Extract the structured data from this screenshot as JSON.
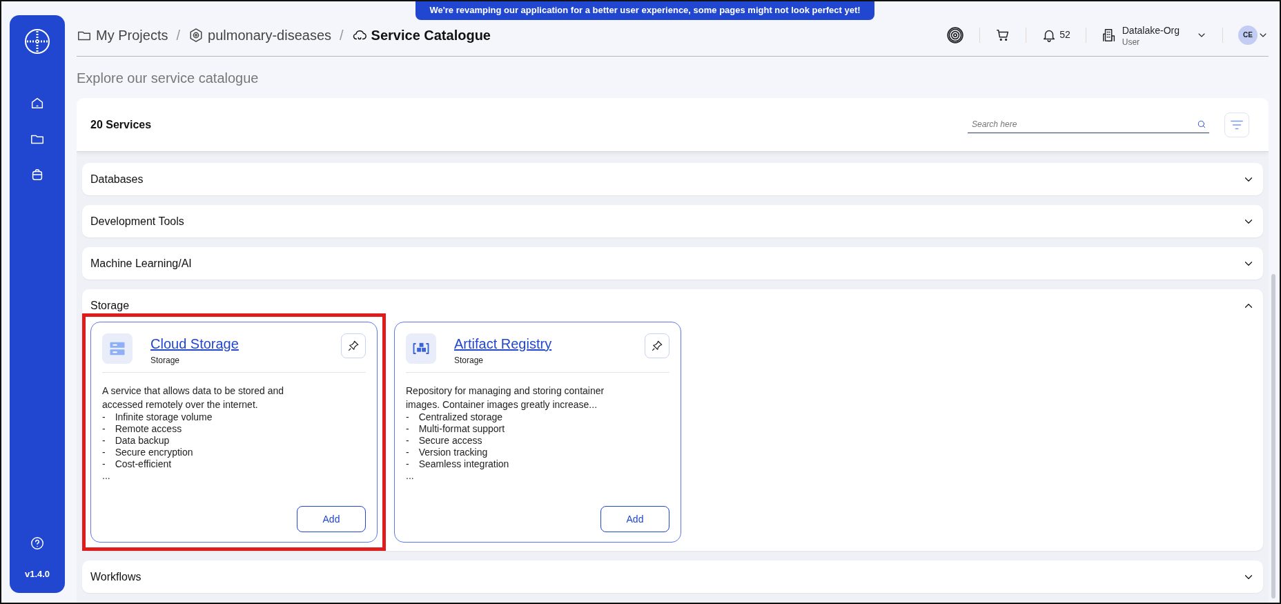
{
  "banner": "We're revamping our application for a better user experience, some pages might not look perfect yet!",
  "sidebar": {
    "version": "v1.4.0"
  },
  "breadcrumbs": {
    "items": [
      {
        "label": "My Projects",
        "current": false
      },
      {
        "label": "pulmonary-diseases",
        "current": false
      },
      {
        "label": "Service Catalogue",
        "current": true
      }
    ],
    "separators": [
      "/",
      "/"
    ]
  },
  "header": {
    "notifications": "52",
    "org": {
      "name": "Datalake-Org",
      "role": "User"
    },
    "avatar": "CE"
  },
  "page_title": "Explore our service catalogue",
  "catalogue": {
    "count": "20 Services",
    "search": {
      "placeholder": "Search here"
    },
    "categories": [
      {
        "name": "Databases",
        "expanded": false
      },
      {
        "name": "Development Tools",
        "expanded": false
      },
      {
        "name": "Machine Learning/AI",
        "expanded": false
      },
      {
        "name": "Storage",
        "expanded": true,
        "services": [
          {
            "kind": "bucket",
            "name": "Cloud Storage",
            "category": "Storage",
            "highlighted": true,
            "description": "A service that allows data to be stored and accessed remotely over the internet.",
            "features": [
              {
                "bullet": "-",
                "text": "Infinite storage volume"
              },
              {
                "bullet": "-",
                "text": "Remote access"
              },
              {
                "bullet": "-",
                "text": "Data backup"
              },
              {
                "bullet": "-",
                "text": "Secure encryption"
              },
              {
                "bullet": "-",
                "text": "Cost-efficient"
              }
            ],
            "more": "...",
            "button": "Add"
          },
          {
            "kind": "registry",
            "name": "Artifact Registry",
            "category": "Storage",
            "highlighted": false,
            "description": "Repository for managing and storing container images. Container images greatly increase...",
            "features": [
              {
                "bullet": "-",
                "text": "Centralized storage"
              },
              {
                "bullet": "-",
                "text": "Multi-format support"
              },
              {
                "bullet": "-",
                "text": "Secure access"
              },
              {
                "bullet": "-",
                "text": "Version tracking"
              },
              {
                "bullet": "-",
                "text": "Seamless integration"
              }
            ],
            "more": "...",
            "button": "Add"
          }
        ]
      },
      {
        "name": "Workflows",
        "expanded": false
      }
    ]
  }
}
